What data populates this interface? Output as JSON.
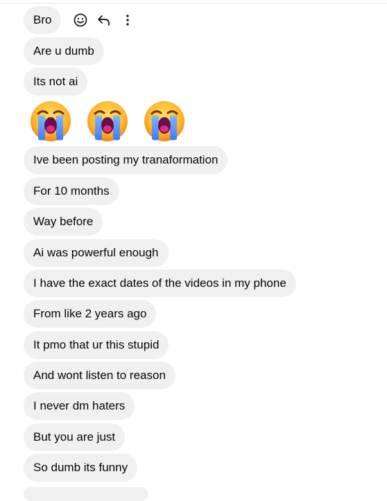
{
  "messages_before_emoji": [
    {
      "text": "Bro"
    },
    {
      "text": "Are u dumb"
    },
    {
      "text": "Its not ai"
    }
  ],
  "hover_actions": {
    "react_icon": "smiley-face-icon",
    "reply_icon": "reply-arrow-icon",
    "more_icon": "more-vertical-icon"
  },
  "emoji_message": {
    "emojis": [
      "loudly-crying-face",
      "loudly-crying-face",
      "loudly-crying-face"
    ]
  },
  "messages_after_emoji": [
    {
      "text": "Ive been posting my tranaformation"
    },
    {
      "text": "For 10 months"
    },
    {
      "text": "Way before"
    },
    {
      "text": "Ai was powerful enough"
    },
    {
      "text": "I have the exact dates of the videos in my phone"
    },
    {
      "text": "From like 2 years ago"
    },
    {
      "text": "It pmo that ur this stupid"
    },
    {
      "text": "And wont listen to reason"
    },
    {
      "text": "I never dm haters"
    },
    {
      "text": "But you are just"
    },
    {
      "text": "So dumb its funny"
    }
  ],
  "colors": {
    "bubble_background": "#f0f0f0",
    "text": "#050505",
    "icon": "#1c1e21"
  }
}
